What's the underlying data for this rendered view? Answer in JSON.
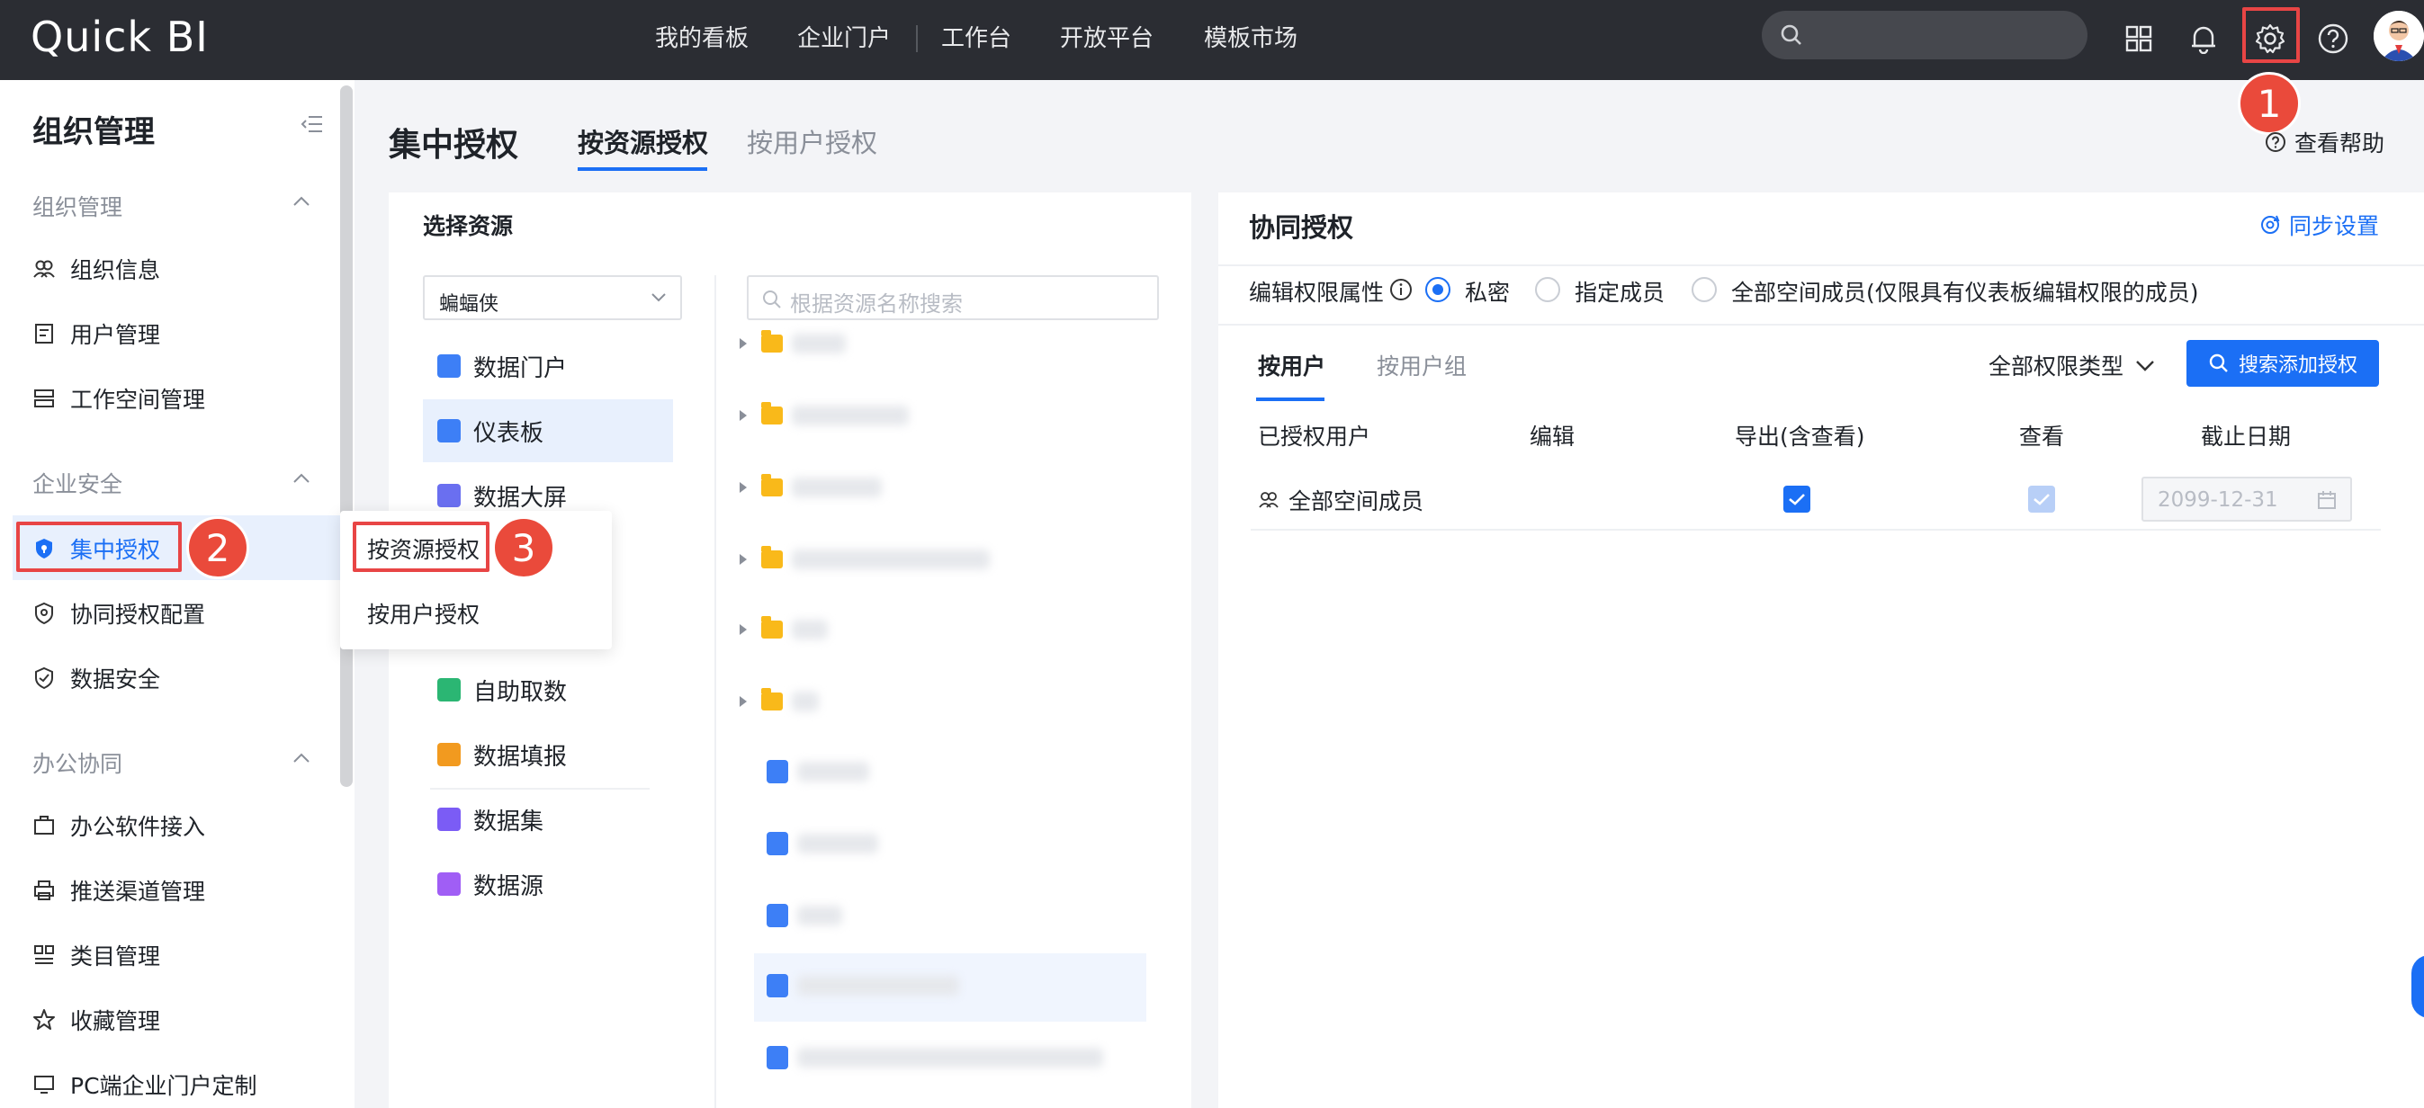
{
  "app": {
    "logo": "Quick BI"
  },
  "topnav": [
    "我的看板",
    "企业门户",
    "工作台",
    "开放平台",
    "模板市场"
  ],
  "top_icons": [
    "apps-grid-icon",
    "bell-icon",
    "settings-gear-icon",
    "help-icon",
    "avatar"
  ],
  "annotations": {
    "badge1": "1",
    "badge2": "2",
    "badge3": "3",
    "highlight_color": "#e84545"
  },
  "sidebar": {
    "title": "组织管理",
    "groups": [
      {
        "label": "组织管理",
        "items": [
          "组织信息",
          "用户管理",
          "工作空间管理"
        ]
      },
      {
        "label": "企业安全",
        "items": [
          "集中授权",
          "协同授权配置",
          "数据安全"
        ]
      },
      {
        "label": "办公协同",
        "items": [
          "办公软件接入",
          "推送渠道管理",
          "类目管理",
          "收藏管理",
          "PC端企业门户定制"
        ]
      }
    ],
    "active": "集中授权"
  },
  "flyout": {
    "items": [
      "按资源授权",
      "按用户授权"
    ]
  },
  "header": {
    "title": "集中授权",
    "tabs": [
      "按资源授权",
      "按用户授权"
    ],
    "active_tab": "按资源授权",
    "help": "查看帮助"
  },
  "resource_panel": {
    "title": "选择资源",
    "workspace_select": "蝙蝠侠",
    "types": [
      {
        "label": "数据门户",
        "color": "#3d7ff6"
      },
      {
        "label": "仪表板",
        "color": "#3d7ff6"
      },
      {
        "label": "数据大屏",
        "color": "#6a6ff0"
      },
      {
        "label": "自助取数",
        "color": "#2bb673"
      },
      {
        "label": "数据填报",
        "color": "#f29a1f"
      },
      {
        "label": "数据集",
        "color": "#7b5cf5"
      },
      {
        "label": "数据源",
        "color": "#a05ef5"
      }
    ],
    "active_type": "仪表板",
    "search_placeholder": "根据资源名称搜索"
  },
  "collab": {
    "title": "协同授权",
    "sync": "同步设置",
    "edit_prop_label": "编辑权限属性",
    "options": [
      "私密",
      "指定成员",
      "全部空间成员(仅限具有仪表板编辑权限的成员)"
    ],
    "selected_option": "私密",
    "subtabs": [
      "按用户",
      "按用户组"
    ],
    "active_subtab": "按用户",
    "perm_type": "全部权限类型",
    "add_button": "搜索添加授权",
    "columns": [
      "已授权用户",
      "编辑",
      "导出(含查看)",
      "查看",
      "截止日期"
    ],
    "rows": [
      {
        "user": "全部空间成员",
        "edit": false,
        "export": true,
        "view": true,
        "view_disabled": true,
        "date": "2099-12-31"
      }
    ]
  },
  "colors": {
    "accent": "#1b6ff5",
    "topbar": "#2b2d33",
    "badge": "#ea4a3b"
  }
}
